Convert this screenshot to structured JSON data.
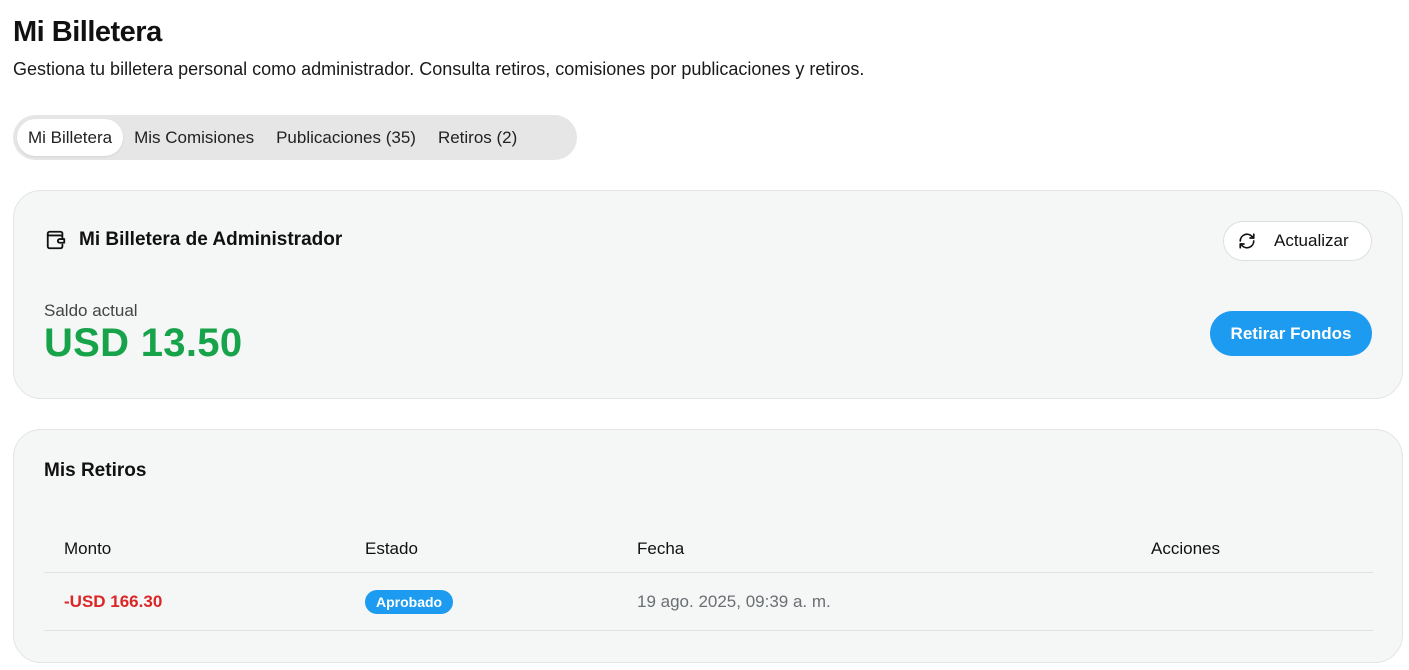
{
  "header": {
    "title": "Mi Billetera",
    "subtitle": "Gestiona tu billetera personal como administrador. Consulta retiros, comisiones por publicaciones y retiros."
  },
  "tabs": [
    {
      "label": "Mi Billetera",
      "active": true
    },
    {
      "label": "Mis Comisiones",
      "active": false
    },
    {
      "label": "Publicaciones (35)",
      "active": false
    },
    {
      "label": "Retiros (2)",
      "active": false
    }
  ],
  "wallet": {
    "title": "Mi Billetera de Administrador",
    "icon": "wallet-icon",
    "refresh_label": "Actualizar",
    "refresh_icon": "refresh-icon",
    "balance_label": "Saldo actual",
    "balance_value": "USD 13.50",
    "withdraw_label": "Retirar Fondos"
  },
  "withdrawals": {
    "title": "Mis Retiros",
    "columns": [
      "Monto",
      "Estado",
      "Fecha",
      "Acciones"
    ],
    "rows": [
      {
        "amount": "-USD 166.30",
        "status": "Aprobado",
        "date": "19 ago. 2025, 09:39 a. m."
      }
    ]
  },
  "colors": {
    "accent": "#1d9bf0",
    "balance": "#16a34a",
    "negative": "#dc2626",
    "card_bg": "#f5f6f6"
  }
}
